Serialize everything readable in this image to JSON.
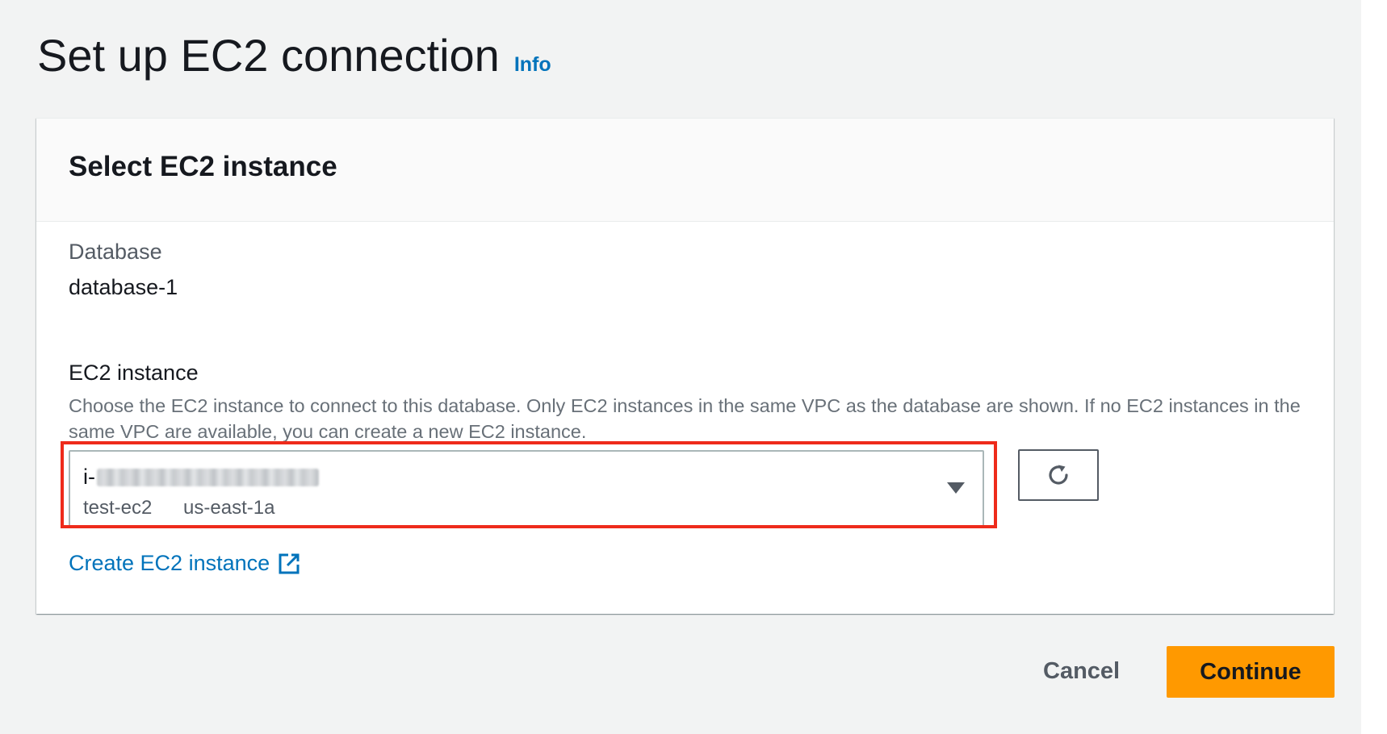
{
  "page": {
    "title": "Set up EC2 connection",
    "info_link": "Info"
  },
  "panel": {
    "title": "Select EC2 instance",
    "database_label": "Database",
    "database_value": "database-1",
    "ec2_label": "EC2 instance",
    "ec2_description": "Choose the EC2 instance to connect to this database. Only EC2 instances in the same VPC as the database are shown. If no EC2 instances in the same VPC are available, you can create a new EC2 instance.",
    "select": {
      "instance_id_prefix": "i-",
      "instance_name": "test-ec2",
      "availability_zone": "us-east-1a"
    },
    "create_link": "Create EC2 instance"
  },
  "footer": {
    "cancel_label": "Cancel",
    "continue_label": "Continue"
  },
  "colors": {
    "accent": "#ff9900",
    "link": "#0073bb",
    "highlight": "#ee2b1b"
  },
  "icons": {
    "refresh": "refresh-icon",
    "caret": "caret-down-icon",
    "external": "external-link-icon"
  }
}
